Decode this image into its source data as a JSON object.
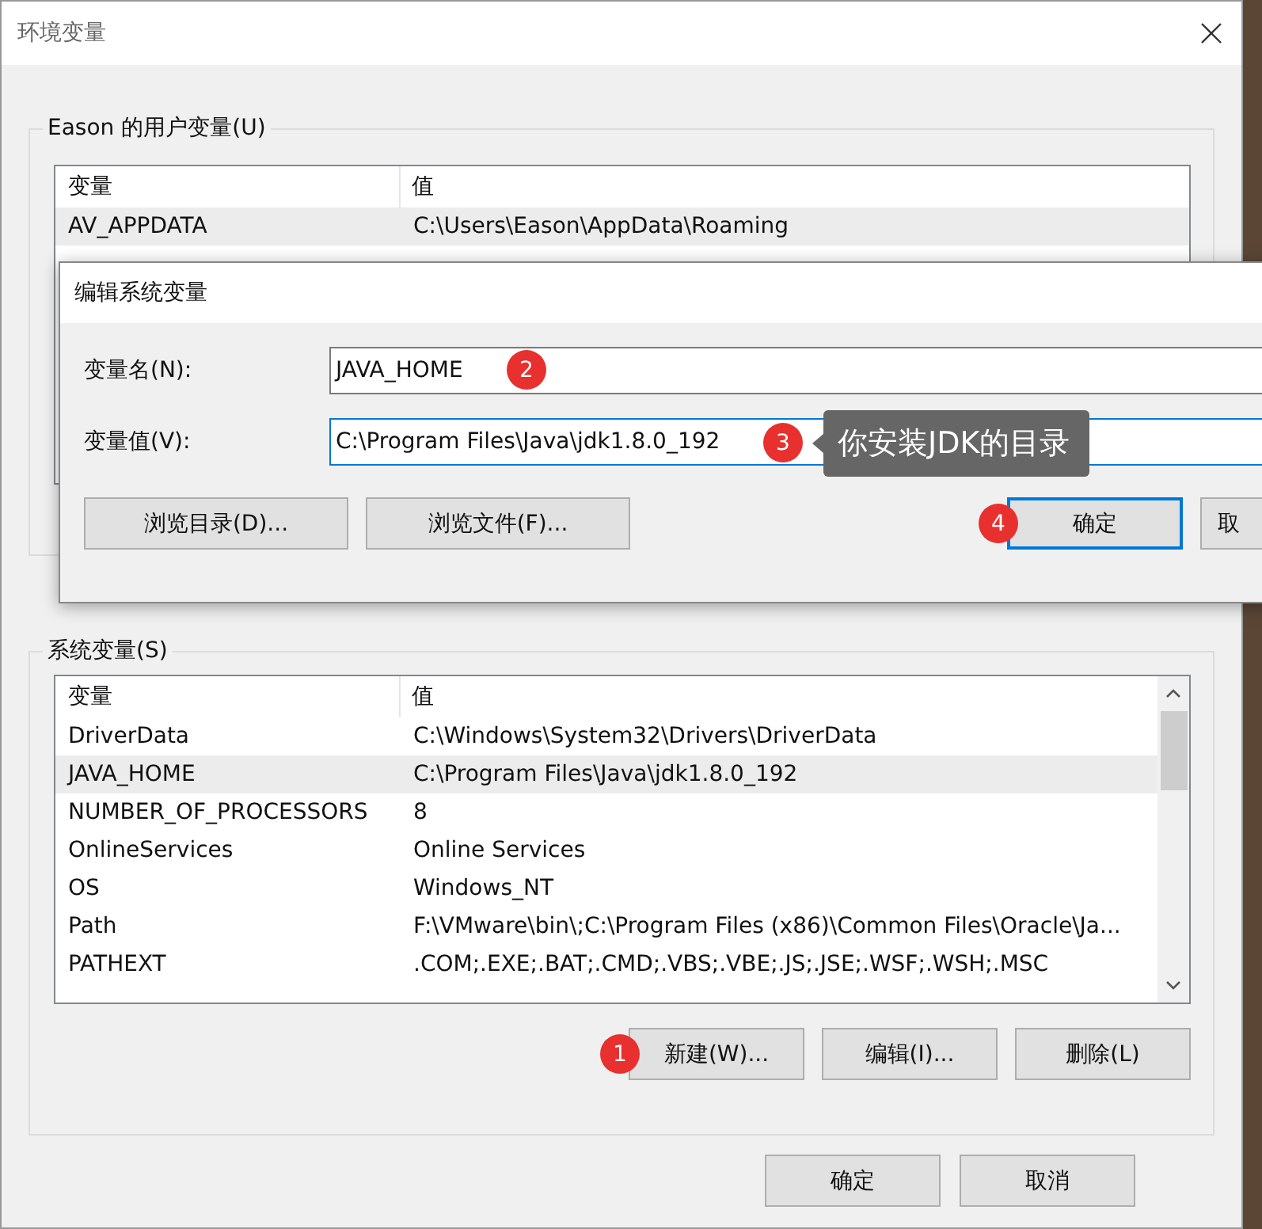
{
  "window": {
    "title": "环境变量"
  },
  "user_vars": {
    "title": "Eason 的用户变量(U)",
    "columns": [
      "变量",
      "值"
    ],
    "rows": [
      {
        "name": "AV_APPDATA",
        "value": "C:\\Users\\Eason\\AppData\\Roaming",
        "selected": true
      }
    ]
  },
  "system_vars": {
    "title": "系统变量(S)",
    "columns": [
      "变量",
      "值"
    ],
    "rows": [
      {
        "name": "DriverData",
        "value": "C:\\Windows\\System32\\Drivers\\DriverData",
        "selected": false
      },
      {
        "name": "JAVA_HOME",
        "value": "C:\\Program Files\\Java\\jdk1.8.0_192",
        "selected": true
      },
      {
        "name": "NUMBER_OF_PROCESSORS",
        "value": "8",
        "selected": false
      },
      {
        "name": "OnlineServices",
        "value": "Online Services",
        "selected": false
      },
      {
        "name": "OS",
        "value": "Windows_NT",
        "selected": false
      },
      {
        "name": "Path",
        "value": "F:\\VMware\\bin\\;C:\\Program Files (x86)\\Common Files\\Oracle\\Ja...",
        "selected": false
      },
      {
        "name": "PATHEXT",
        "value": ".COM;.EXE;.BAT;.CMD;.VBS;.VBE;.JS;.JSE;.WSF;.WSH;.MSC",
        "selected": false
      }
    ],
    "buttons": [
      {
        "label": "新建(W)...",
        "callout": "1"
      },
      {
        "label": "编辑(I)..."
      },
      {
        "label": "删除(L)"
      }
    ]
  },
  "buttons": [
    "确定",
    "取消"
  ],
  "edit_dialog": {
    "title": "编辑系统变量",
    "fields": [
      {
        "label": "变量名(N):",
        "value": "JAVA_HOME",
        "callout": "2"
      },
      {
        "label": "变量值(V):",
        "value": "C:\\Program Files\\Java\\jdk1.8.0_192",
        "callout": "3",
        "note": "你安装JDK的目录"
      }
    ],
    "browse_buttons": [
      "浏览目录(D)...",
      "浏览文件(F)..."
    ],
    "buttons": [
      {
        "label": "确定",
        "default": true,
        "callout": "4"
      },
      {
        "label": "取",
        "default": false
      }
    ]
  }
}
